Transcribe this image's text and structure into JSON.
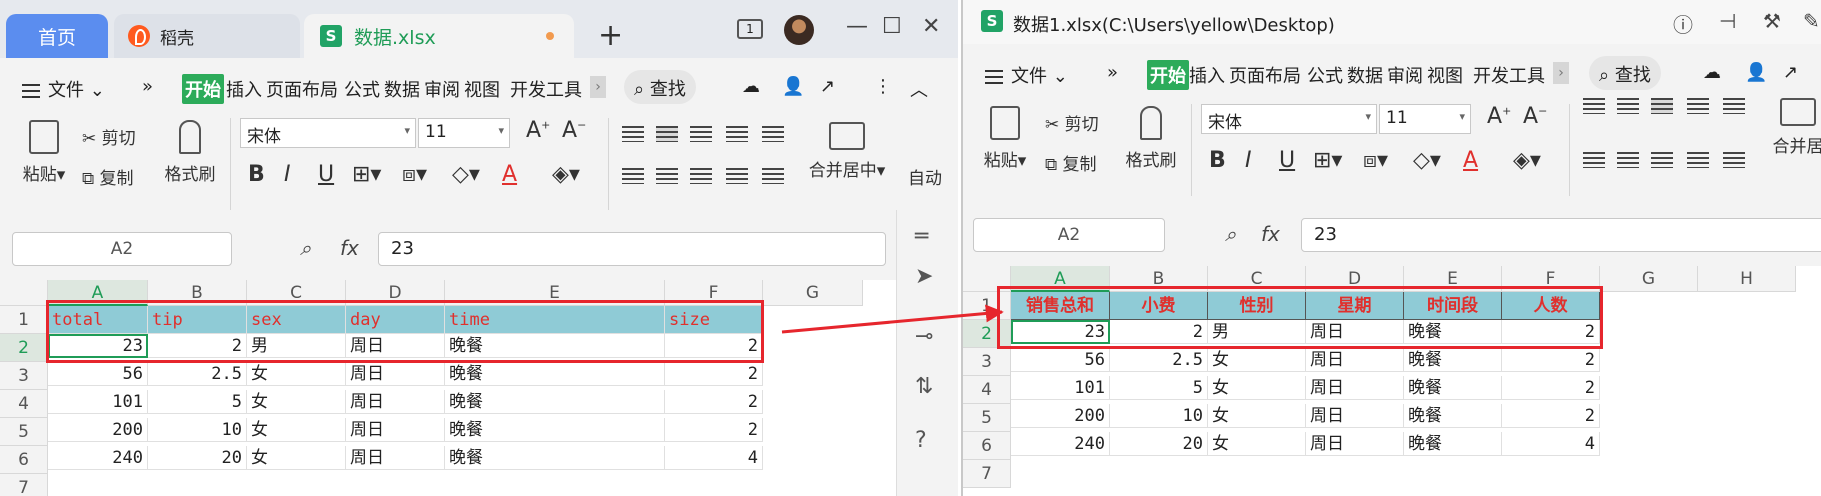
{
  "left": {
    "tabs": {
      "home": "首页",
      "daoke": "稻壳",
      "file": "数据.xlsx",
      "new": "+"
    },
    "window_buttons": {
      "frame": "1",
      "minimize": "—",
      "maximize": "☐",
      "close": "✕"
    },
    "menu": {
      "file": "文件",
      "more": "»",
      "items": [
        "开始",
        "插入",
        "页面布局",
        "公式",
        "数据",
        "审阅",
        "视图",
        "开发工具"
      ],
      "search": "查找",
      "more_v": "⋮",
      "collapse": "︿"
    },
    "ribbon": {
      "paste": "粘贴",
      "cut": "剪切",
      "copy": "复制",
      "format_painter": "格式刷",
      "font": "宋体",
      "size": "11",
      "merge": "合并居中",
      "auto": "自动"
    },
    "namebox": "A2",
    "formula": "23",
    "columns": [
      "A",
      "B",
      "C",
      "D",
      "E",
      "F",
      "G"
    ],
    "rows": [
      "1",
      "2",
      "3",
      "4",
      "5",
      "6",
      "7"
    ],
    "header": [
      "total",
      "tip",
      "sex",
      "day",
      "time",
      "size"
    ],
    "data": [
      [
        "23",
        "2",
        "男",
        "周日",
        "晚餐",
        "2"
      ],
      [
        "56",
        "2.5",
        "女",
        "周日",
        "晚餐",
        "2"
      ],
      [
        "101",
        "5",
        "女",
        "周日",
        "晚餐",
        "2"
      ],
      [
        "200",
        "10",
        "女",
        "周日",
        "晚餐",
        "2"
      ],
      [
        "240",
        "20",
        "女",
        "周日",
        "晚餐",
        "4"
      ]
    ]
  },
  "right": {
    "title": "数据1.xlsx(C:\\Users\\yellow\\Desktop)",
    "menu": {
      "file": "文件",
      "more": "»",
      "items": [
        "开始",
        "插入",
        "页面布局",
        "公式",
        "数据",
        "审阅",
        "视图",
        "开发工具"
      ],
      "search": "查找"
    },
    "ribbon": {
      "paste": "粘贴",
      "cut": "剪切",
      "copy": "复制",
      "format_painter": "格式刷",
      "font": "宋体",
      "size": "11",
      "merge": "合并居"
    },
    "namebox": "A2",
    "formula": "23",
    "columns": [
      "A",
      "B",
      "C",
      "D",
      "E",
      "F",
      "G",
      "H"
    ],
    "rows": [
      "1",
      "2",
      "3",
      "4",
      "5",
      "6",
      "7"
    ],
    "header": [
      "销售总和",
      "小费",
      "性别",
      "星期",
      "时间段",
      "人数"
    ],
    "data": [
      [
        "23",
        "2",
        "男",
        "周日",
        "晚餐",
        "2"
      ],
      [
        "56",
        "2.5",
        "女",
        "周日",
        "晚餐",
        "2"
      ],
      [
        "101",
        "5",
        "女",
        "周日",
        "晚餐",
        "2"
      ],
      [
        "200",
        "10",
        "女",
        "周日",
        "晚餐",
        "2"
      ],
      [
        "240",
        "20",
        "女",
        "周日",
        "晚餐",
        "4"
      ]
    ]
  },
  "colors": {
    "accent": "#1f9c57",
    "header_fill": "#8fcbd6",
    "header_text": "#e0302d",
    "annotation": "#e6262d",
    "home_tab": "#5b8def"
  }
}
